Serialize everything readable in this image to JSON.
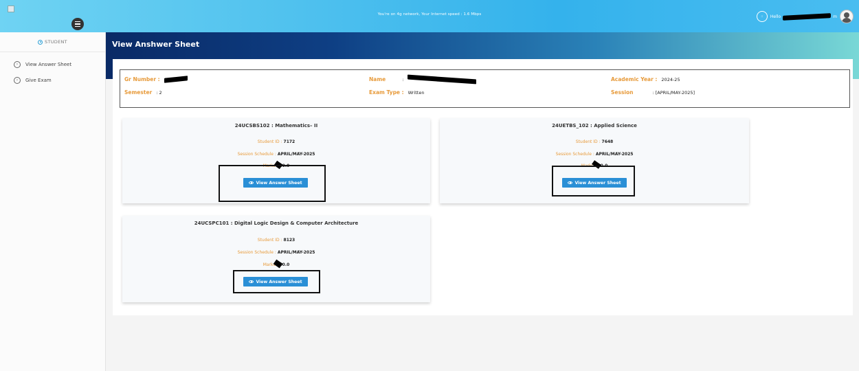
{
  "topbar": {
    "network_message": "You're on 4g network, Your    Internet speed : 1.6 Mbps",
    "user_badge": "::",
    "hello": "Hello",
    "user_suffix": "m"
  },
  "sidebar": {
    "heading": "STUDENT",
    "items": [
      {
        "label": "View Answer Sheet"
      },
      {
        "label": "Give Exam"
      }
    ]
  },
  "page": {
    "title": "View Anshwer Sheet"
  },
  "info": {
    "gr_number_label": "Gr Number :",
    "name_label": "Name",
    "name_sep": ":",
    "academic_year_label": "Academic Year :",
    "academic_year_value": "2024-25",
    "semester_label": "Semester",
    "semester_value": ": 2",
    "exam_type_label": "Exam Type :",
    "exam_type_value": "Written",
    "session_label": "Session",
    "session_value": ": [APRIL/MAY-2025]"
  },
  "cards": [
    {
      "title": "24UCSBS102 : Mathematics– II",
      "student_id_label": "Student ID :",
      "student_id": "7172",
      "schedule_label": "Session Schedule :",
      "schedule": "APRIL/MAY-2025",
      "marks_label": "Marks :",
      "marks": "60.0",
      "button": "View Answer Sheet"
    },
    {
      "title": "24UETBS_102 : Applied Science",
      "student_id_label": "Student ID :",
      "student_id": "7648",
      "schedule_label": "Session Schedule :",
      "schedule": "APRIL/MAY-2025",
      "marks_label": "Marks :",
      "marks": "60.0",
      "button": "View Answer Sheet"
    },
    {
      "title": "24UCSPC101 : Digital Logic Design & Computer Architecture",
      "student_id_label": "Student ID :",
      "student_id": "8123",
      "schedule_label": "Session Schedule :",
      "schedule": "APRIL/MAY-2025",
      "marks_label": "Marks :",
      "marks": "60.0",
      "button": "View Answer Sheet"
    }
  ],
  "colors": {
    "accent_button": "#2a8fd6",
    "label_orange": "#e79a3a",
    "header_dark": "#0a2a66"
  }
}
